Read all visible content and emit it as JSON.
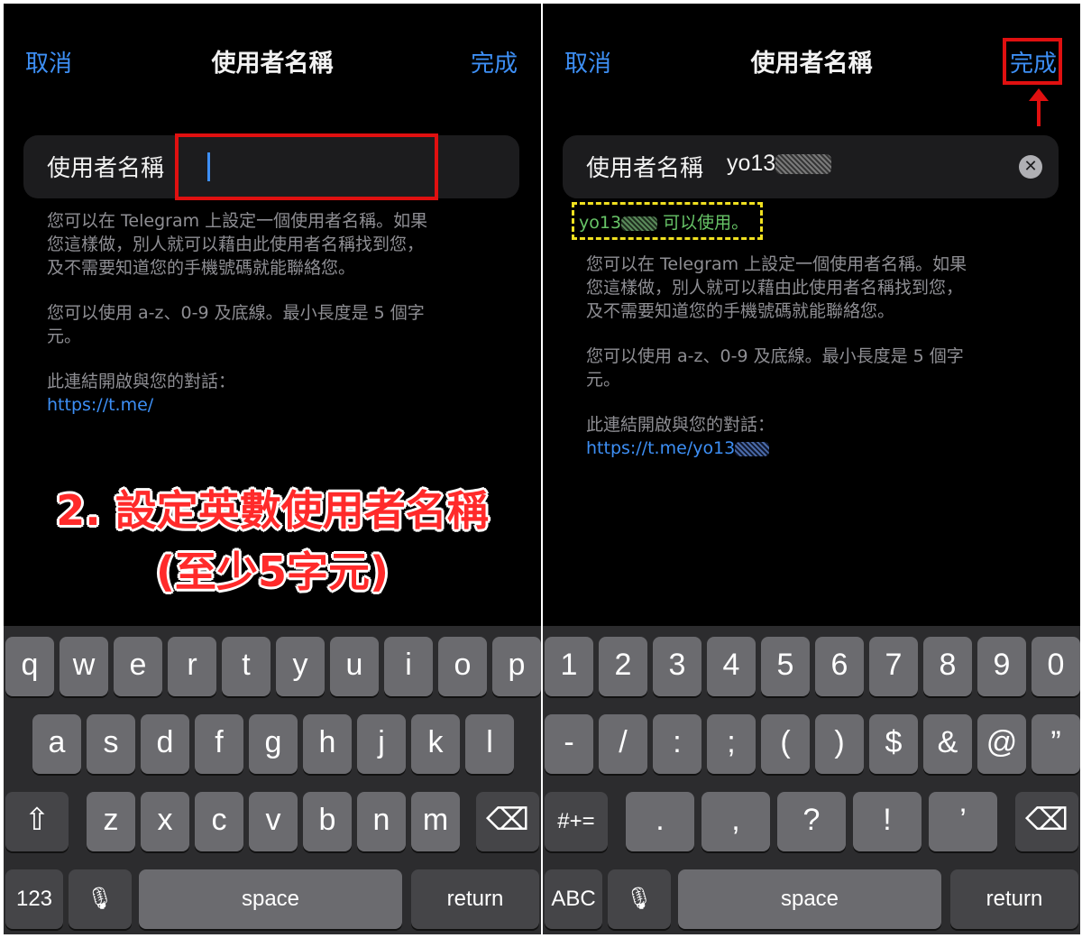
{
  "left": {
    "nav": {
      "cancel": "取消",
      "title": "使用者名稱",
      "done": "完成"
    },
    "field": {
      "label": "使用者名稱"
    },
    "hint1": [
      "您可以在 Telegram 上設定一個使用者名稱。如果",
      "您這樣做，別人就可以藉由此使用者名稱找到您，",
      "及不需要知道您的手機號碼就能聯絡您。"
    ],
    "hint2": [
      "您可以使用 a-z、0-9 及底線。最小長度是 5 個字",
      "元。"
    ],
    "link_label": "此連結開啟與您的對話：",
    "link": "https://t.me/",
    "annotation": [
      "2. 設定英數使用者名稱",
      "(至少5字元)"
    ],
    "keyboard": {
      "row1": [
        "q",
        "w",
        "e",
        "r",
        "t",
        "y",
        "u",
        "i",
        "o",
        "p"
      ],
      "row2": [
        "a",
        "s",
        "d",
        "f",
        "g",
        "h",
        "j",
        "k",
        "l"
      ],
      "row3": [
        "z",
        "x",
        "c",
        "v",
        "b",
        "n",
        "m"
      ],
      "shift": "⇧",
      "backspace": "⌫",
      "mode": "123",
      "mic": "🎙",
      "space": "space",
      "return": "return"
    }
  },
  "right": {
    "nav": {
      "cancel": "取消",
      "title": "使用者名稱",
      "done": "完成"
    },
    "field": {
      "label": "使用者名稱",
      "value": "yo13",
      "clear": "✕"
    },
    "availability": {
      "prefix": "yo13",
      "suffix": "可以使用。"
    },
    "hint1": [
      "您可以在 Telegram 上設定一個使用者名稱。如果",
      "您這樣做，別人就可以藉由此使用者名稱找到您，",
      "及不需要知道您的手機號碼就能聯絡您。"
    ],
    "hint2": [
      "您可以使用 a-z、0-9 及底線。最小長度是 5 個字",
      "元。"
    ],
    "link_label": "此連結開啟與您的對話：",
    "link": "https://t.me/yo13",
    "keyboard": {
      "row1": [
        "1",
        "2",
        "3",
        "4",
        "5",
        "6",
        "7",
        "8",
        "9",
        "0"
      ],
      "row2": [
        "-",
        "/",
        ":",
        ";",
        "(",
        ")",
        "$",
        "&",
        "@",
        "”"
      ],
      "row3": [
        ".",
        ",",
        "?",
        "!",
        "’"
      ],
      "symbols": "#+=",
      "backspace": "⌫",
      "mode": "ABC",
      "mic": "🎙",
      "space": "space",
      "return": "return"
    }
  }
}
